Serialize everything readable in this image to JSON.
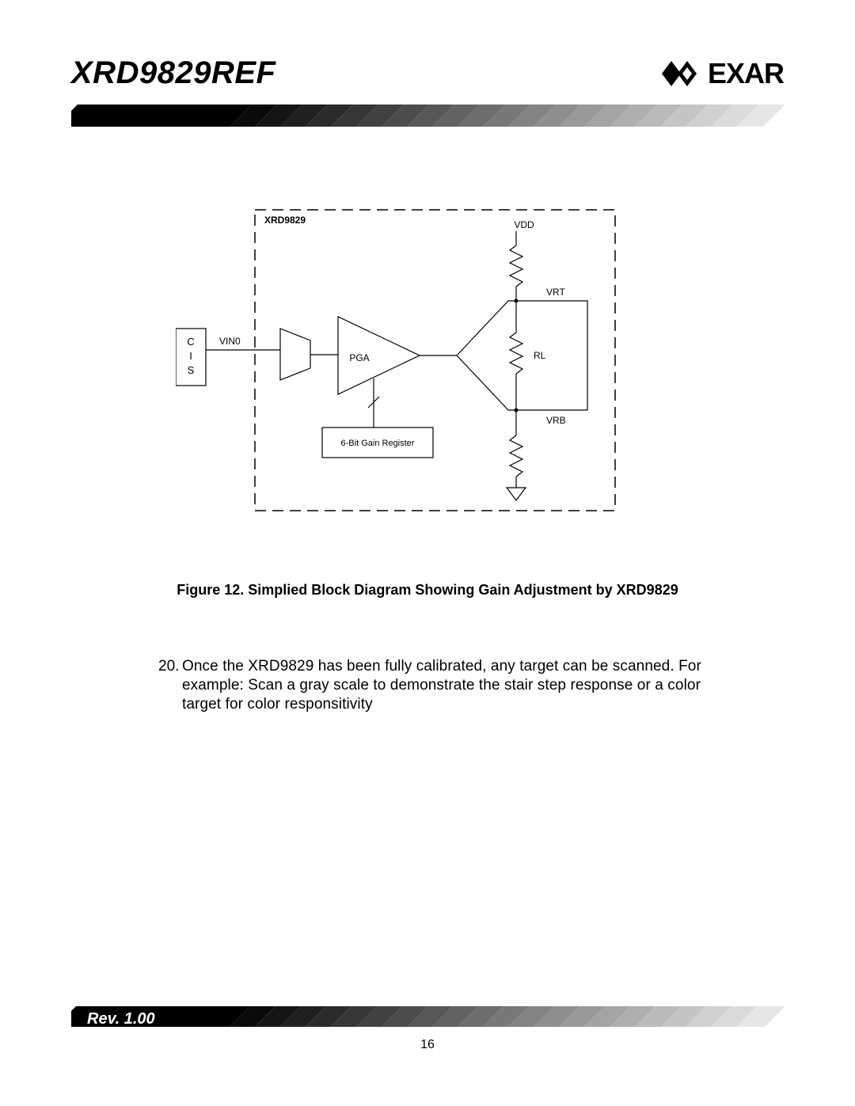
{
  "header": {
    "title": "XRD9829REF",
    "brand": "EXAR"
  },
  "figure": {
    "chip_label": "XRD9829",
    "cis_block": "C\nI\nS",
    "vin0": "VIN0",
    "pga": "PGA",
    "gain_reg": "6-Bit Gain Register",
    "vdd": "VDD",
    "vrt": "VRT",
    "rl": "RL",
    "vrb": "VRB",
    "caption": "Figure 12.  Simplied Block Diagram Showing Gain Adjustment by XRD9829"
  },
  "body": {
    "item_num": "20.",
    "text": "Once the XRD9829 has been fully calibrated, any target can be scanned.  For example:  Scan a gray scale to demonstrate the stair step response or a color target for color responsitivity"
  },
  "footer": {
    "rev": "Rev. 1.00",
    "page": "16"
  }
}
